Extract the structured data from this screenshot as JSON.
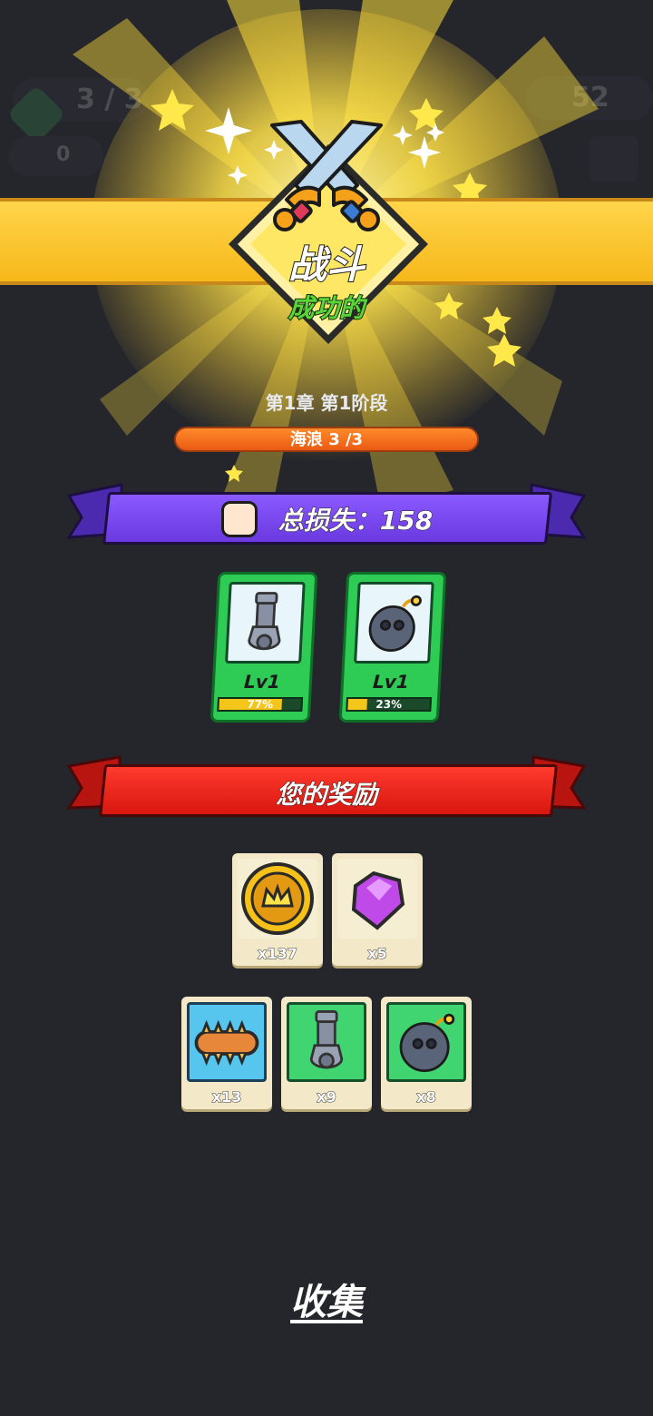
{
  "hud": {
    "wave_counter": "3 / 3",
    "small_counter": "0",
    "gem_counter": "52"
  },
  "victory": {
    "title": "战斗",
    "subtitle": "成功的"
  },
  "stage": {
    "label": "第1章 第1阶段",
    "wave_label": "海浪 3 /3"
  },
  "damage": {
    "label": "总损失：158"
  },
  "skill_cards": [
    {
      "name": "cannon",
      "level": "Lv1",
      "progress_text": "77%",
      "progress": 0.77
    },
    {
      "name": "bomb",
      "level": "Lv1",
      "progress_text": "23%",
      "progress": 0.23
    }
  ],
  "rewards": {
    "title": "您的奖励",
    "items": [
      {
        "icon": "coin-crown-icon",
        "count": "x137"
      },
      {
        "icon": "purple-gem-icon",
        "count": "x5"
      },
      {
        "icon": "spiked-club-icon",
        "count": "x13"
      },
      {
        "icon": "cannon-icon",
        "count": "x9"
      },
      {
        "icon": "bomb-icon",
        "count": "x8"
      }
    ]
  },
  "collect_label": "收集",
  "colors": {
    "background": "#25262c",
    "gold_banner": "#ffcf3a",
    "purple_ribbon": "#6d3de0",
    "red_ribbon": "#e8231d",
    "card_green": "#2ecc55",
    "wave_orange": "#f06a1c"
  }
}
